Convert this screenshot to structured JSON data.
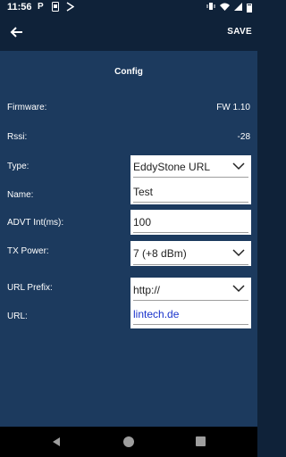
{
  "status_bar": {
    "time": "11:56",
    "notification_icons": [
      "parking-icon",
      "sim-icon",
      "download-icon"
    ]
  },
  "app_bar": {
    "save_label": "SAVE"
  },
  "config": {
    "title": "Config",
    "firmware_label": "Firmware:",
    "firmware_value": "FW 1.10",
    "rssi_label": "Rssi:",
    "rssi_value": "-28",
    "type_label": "Type:",
    "type_value": "EddyStone URL",
    "name_label": "Name:",
    "name_value": "Test",
    "advt_label": "ADVT Int(ms):",
    "advt_value": "100",
    "tx_label": "TX Power:",
    "tx_value": "7 (+8 dBm)",
    "url_prefix_label": "URL Prefix:",
    "url_prefix_value": "http://",
    "url_label": "URL:",
    "url_value": "lintech.de"
  },
  "colors": {
    "header": "#0f2239",
    "content": "#1c3a5e",
    "link": "#1a33cc"
  }
}
